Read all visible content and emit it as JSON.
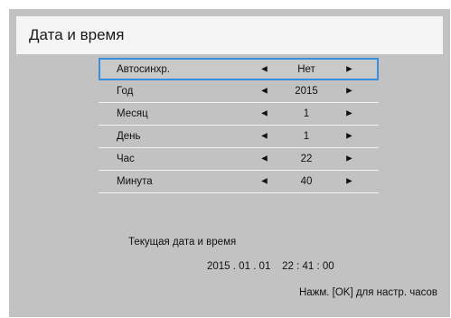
{
  "title": "Дата и время",
  "settings": [
    {
      "label": "Автосинхр.",
      "value": "Нет",
      "selected": true
    },
    {
      "label": "Год",
      "value": "2015",
      "selected": false
    },
    {
      "label": "Месяц",
      "value": "1",
      "selected": false
    },
    {
      "label": "День",
      "value": "1",
      "selected": false
    },
    {
      "label": "Час",
      "value": "22",
      "selected": false
    },
    {
      "label": "Минута",
      "value": "40",
      "selected": false
    }
  ],
  "arrows": {
    "left": "◄",
    "right": "►"
  },
  "current": {
    "label": "Текущая дата и время",
    "value": "2015 . 01 . 01    22 : 41 : 00"
  },
  "hint": "Нажм. [OK] для настр. часов",
  "colors": {
    "panel": "#c2c2c2",
    "title_bar": "#f5f5f5",
    "focus_border": "#3a8ee0",
    "row_divider": "#f2f2f2"
  }
}
